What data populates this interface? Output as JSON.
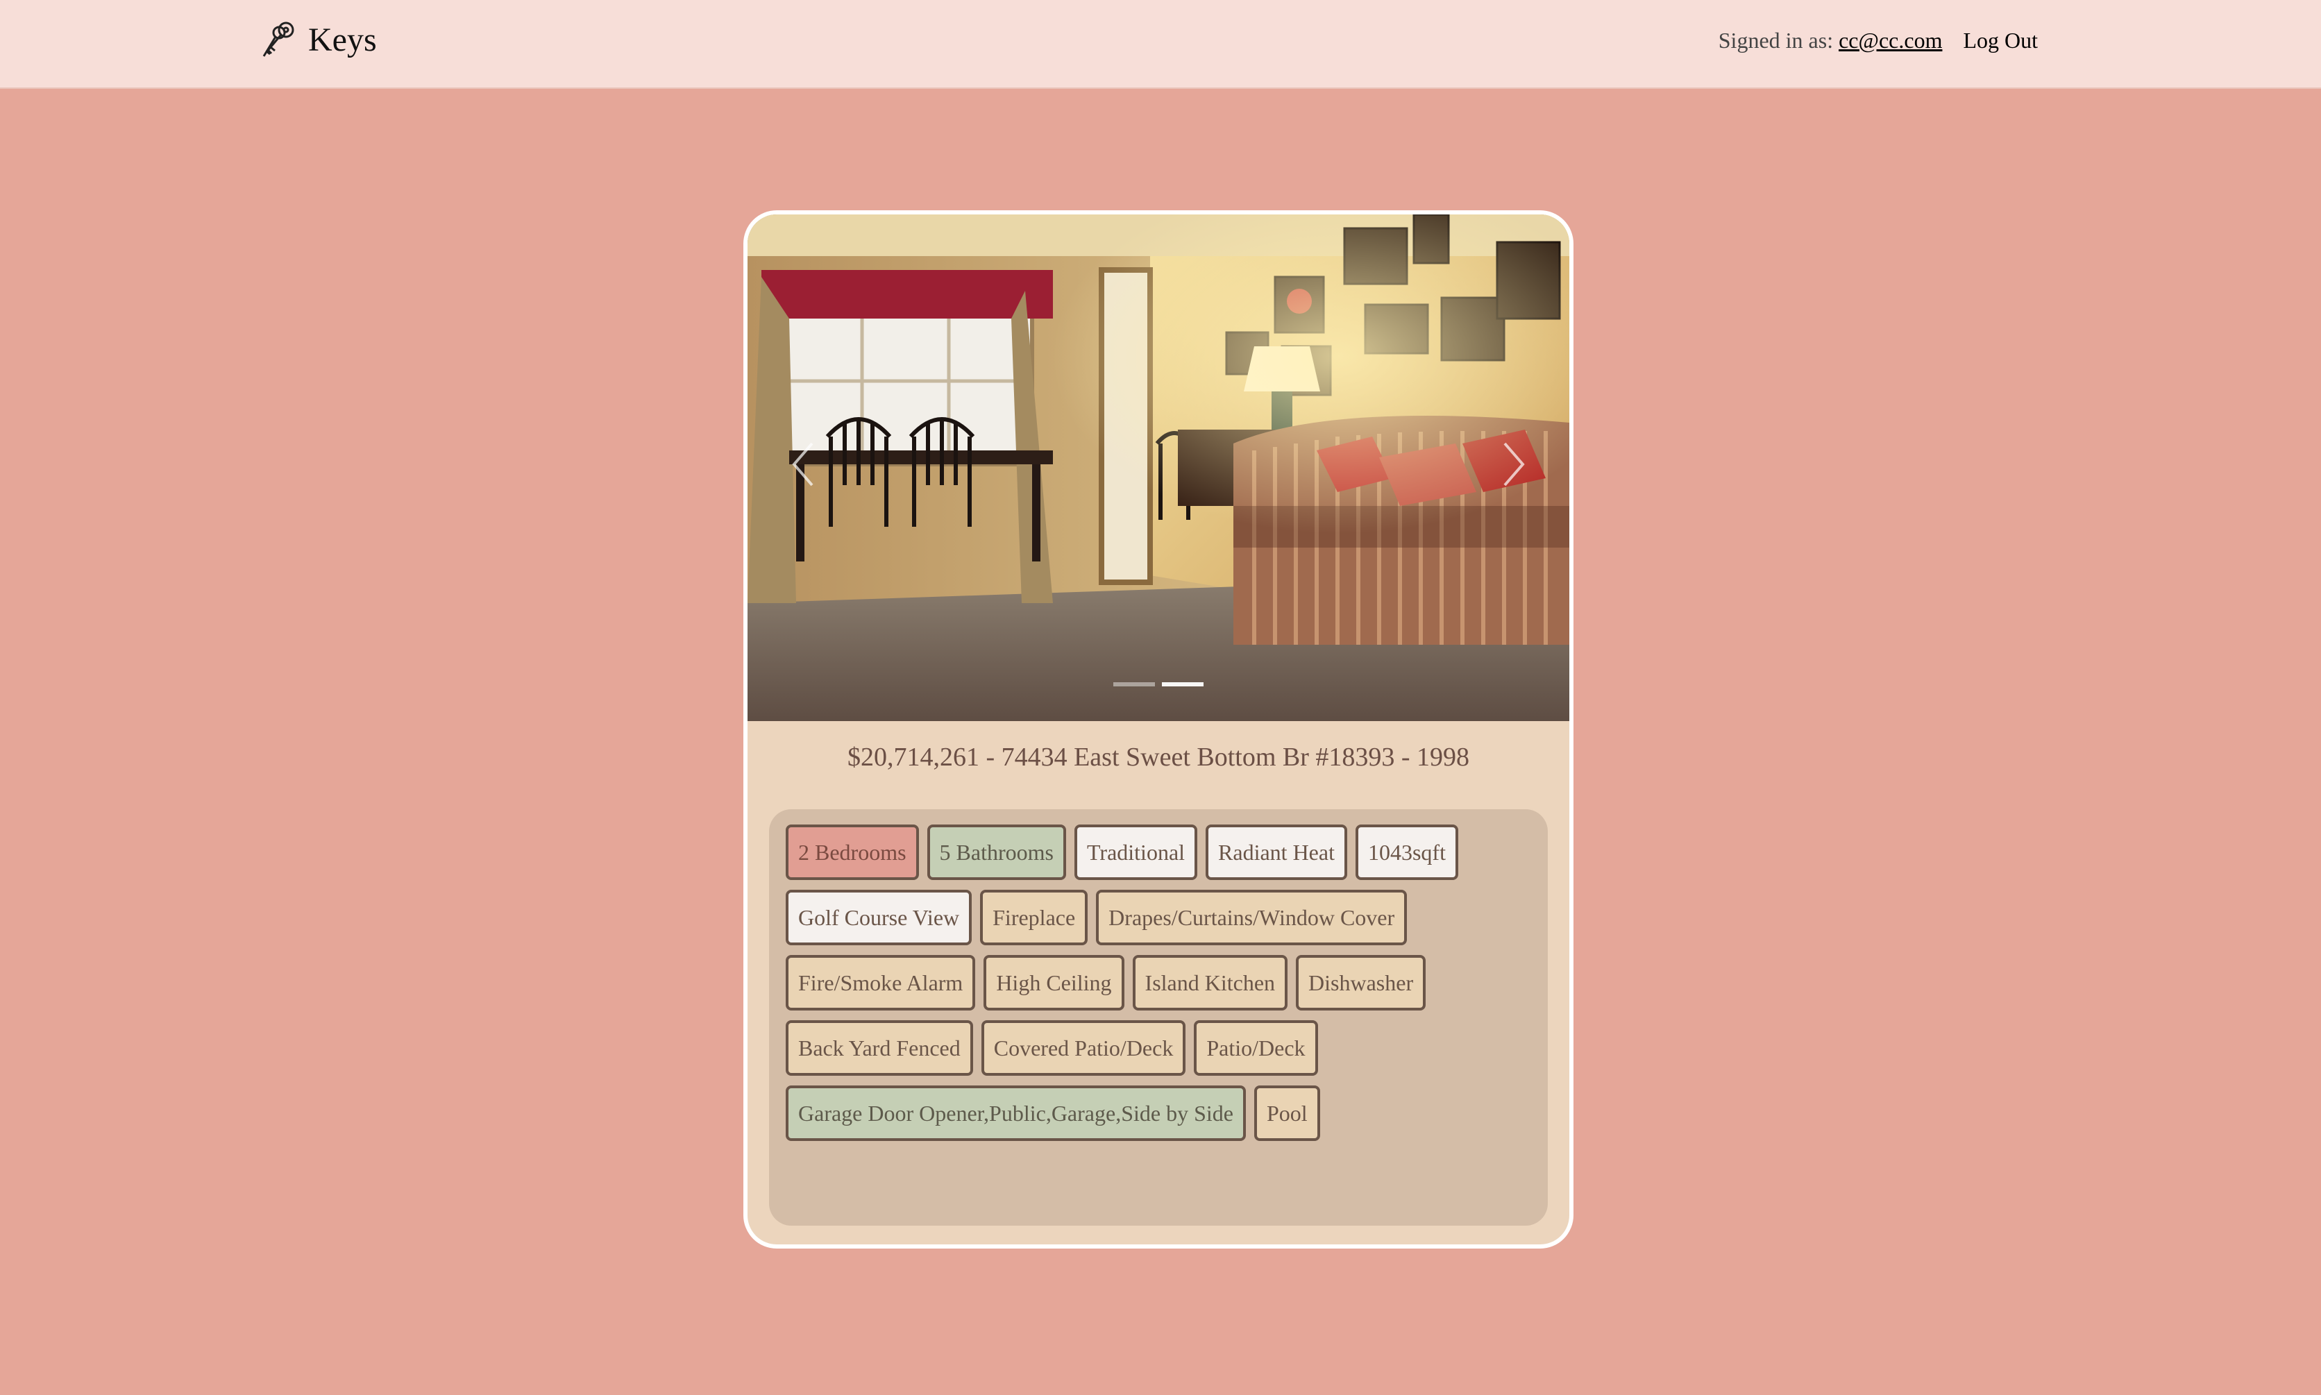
{
  "app": {
    "name": "Keys"
  },
  "header": {
    "signed_in_label": "Signed in as:",
    "email": "cc@cc.com",
    "logout_label": "Log Out"
  },
  "carousel": {
    "slide_count": 2,
    "active_slide": 2
  },
  "listing": {
    "title": "$20,714,261 - 74434 East Sweet Bottom Br #18393 - 1998"
  },
  "tags": {
    "rows": [
      [
        {
          "label": "2 Bedrooms",
          "style": "red"
        },
        {
          "label": "5 Bathrooms",
          "style": "green"
        },
        {
          "label": "Traditional",
          "style": "white"
        },
        {
          "label": "Radiant Heat",
          "style": "white"
        },
        {
          "label": "1043sqft",
          "style": "white"
        }
      ],
      [
        {
          "label": "Golf Course View",
          "style": "white"
        },
        {
          "label": "Fireplace",
          "style": "tan"
        },
        {
          "label": "Drapes/Curtains/Window Cover",
          "style": "tan"
        }
      ],
      [
        {
          "label": "Fire/Smoke Alarm",
          "style": "tan"
        },
        {
          "label": "High Ceiling",
          "style": "tan"
        },
        {
          "label": "Island Kitchen",
          "style": "tan"
        },
        {
          "label": "Dishwasher",
          "style": "tan"
        }
      ],
      [
        {
          "label": "Back Yard Fenced",
          "style": "tan"
        },
        {
          "label": "Covered Patio/Deck",
          "style": "tan"
        },
        {
          "label": "Patio/Deck",
          "style": "tan"
        }
      ],
      [
        {
          "label": "Garage Door Opener,Public,Garage,Side by Side",
          "style": "green"
        },
        {
          "label": "Pool",
          "style": "tan"
        }
      ]
    ]
  },
  "colors": {
    "background": "#e5a698",
    "header": "#f7ded8",
    "card": "#ecd5bd",
    "tag_panel": "#d4bda7",
    "tag_red": "#e19e93",
    "tag_green": "#c5cfb5",
    "tag_white": "#f5f1ee",
    "tag_tan": "#ead4b4"
  }
}
